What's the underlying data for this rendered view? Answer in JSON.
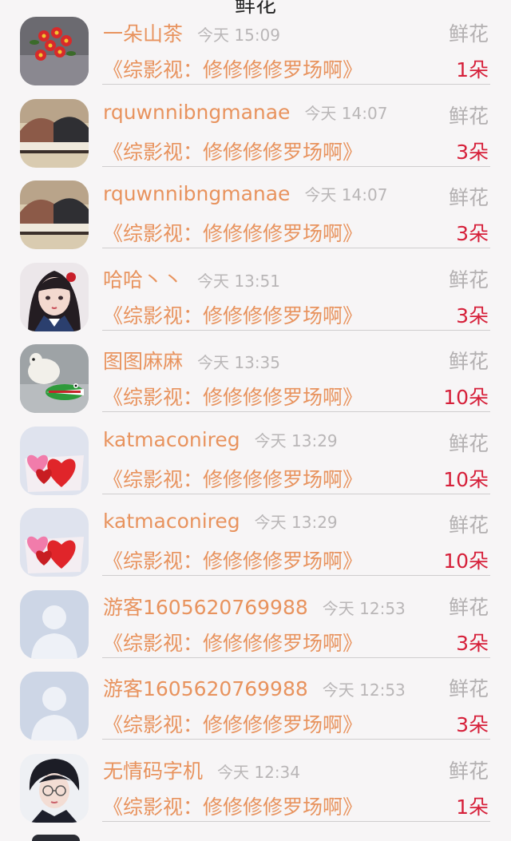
{
  "header": {
    "title": "鲜花"
  },
  "items": [
    {
      "name": "一朵山茶",
      "time": "今天 15:09",
      "type": "鲜花",
      "book": "《综影视：修修修修罗场啊》",
      "count": "1朵",
      "avatar": "flower-avatar"
    },
    {
      "name": "rquwnnibngmanae",
      "time": "今天 14:07",
      "type": "鲜花",
      "book": "《综影视：修修修修罗场啊》",
      "count": "3朵",
      "avatar": "shoes-avatar"
    },
    {
      "name": "rquwnnibngmanae",
      "time": "今天 14:07",
      "type": "鲜花",
      "book": "《综影视：修修修修罗场啊》",
      "count": "3朵",
      "avatar": "shoes-avatar"
    },
    {
      "name": "哈哈丶丶",
      "time": "今天 13:51",
      "type": "鲜花",
      "book": "《综影视：修修修修罗场啊》",
      "count": "3朵",
      "avatar": "girl-avatar"
    },
    {
      "name": "图图麻麻",
      "time": "今天 13:35",
      "type": "鲜花",
      "book": "《综影视：修修修修罗场啊》",
      "count": "10朵",
      "avatar": "dog-croc-avatar"
    },
    {
      "name": "katmaconireg",
      "time": "今天 13:29",
      "type": "鲜花",
      "book": "《综影视：修修修修罗场啊》",
      "count": "10朵",
      "avatar": "hearts-avatar"
    },
    {
      "name": "katmaconireg",
      "time": "今天 13:29",
      "type": "鲜花",
      "book": "《综影视：修修修修罗场啊》",
      "count": "10朵",
      "avatar": "hearts-avatar"
    },
    {
      "name": "游客1605620769988",
      "time": "今天 12:53",
      "type": "鲜花",
      "book": "《综影视：修修修修罗场啊》",
      "count": "3朵",
      "avatar": "default-avatar"
    },
    {
      "name": "游客1605620769988",
      "time": "今天 12:53",
      "type": "鲜花",
      "book": "《综影视：修修修修罗场啊》",
      "count": "3朵",
      "avatar": "default-avatar"
    },
    {
      "name": "无情码字机",
      "time": "今天 12:34",
      "type": "鲜花",
      "book": "《综影视：修修修修罗场啊》",
      "count": "1朵",
      "avatar": "boy-avatar"
    }
  ],
  "colors": {
    "name_accent": "#e8935e",
    "count_red": "#d6203a",
    "muted": "#b9b6b7",
    "background": "#f7f5f6"
  }
}
